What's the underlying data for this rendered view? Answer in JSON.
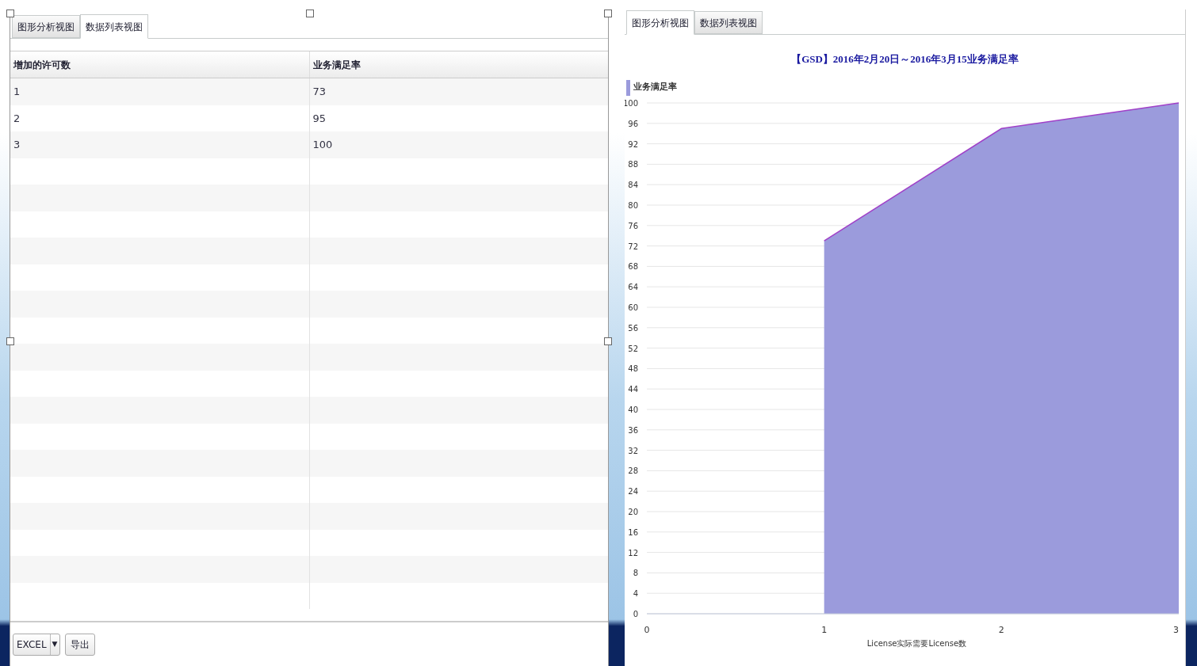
{
  "list_panel": {
    "tabs": [
      {
        "label": "图形分析视图",
        "selected": false
      },
      {
        "label": "数据列表视图",
        "selected": true
      }
    ],
    "table": {
      "columns": [
        "增加的许可数",
        "业务满足率"
      ],
      "rows": [
        [
          "1",
          "73"
        ],
        [
          "2",
          "95"
        ],
        [
          "3",
          "100"
        ]
      ]
    },
    "export_format": "EXCEL",
    "dropdown_arrow": "▼",
    "export_button": "导出"
  },
  "chart_panel": {
    "tabs": [
      {
        "label": "图形分析视图",
        "selected": true
      },
      {
        "label": "数据列表视图",
        "selected": false
      }
    ],
    "chart_data": {
      "type": "area",
      "title": "【GSD】2016年2月20日～2016年3月15业务满足率",
      "xlabel": "License实际需要License数",
      "x": [
        1,
        2,
        3
      ],
      "series": [
        {
          "name": "业务满足率",
          "color": "#9b9bdc",
          "values": [
            73,
            95,
            100
          ]
        }
      ],
      "grid": true,
      "xlim": [
        0,
        3
      ],
      "ylim": [
        0,
        100
      ],
      "xticks": [
        0,
        1,
        2,
        3
      ],
      "yticks": [
        0,
        4,
        8,
        12,
        16,
        20,
        24,
        28,
        32,
        36,
        40,
        44,
        48,
        52,
        56,
        60,
        64,
        68,
        72,
        76,
        80,
        84,
        88,
        92,
        96,
        100
      ]
    }
  }
}
